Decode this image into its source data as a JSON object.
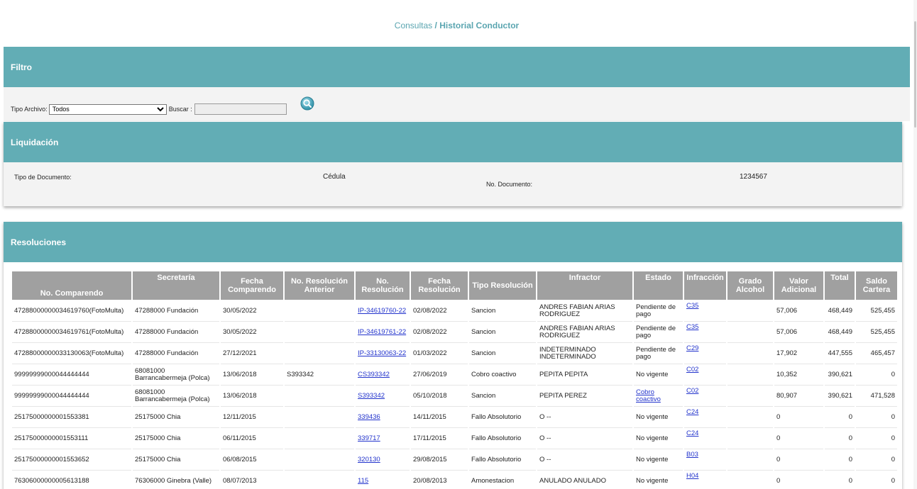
{
  "breadcrumb": {
    "parent": "Consultas",
    "separator": " / ",
    "current": "Historial Conductor"
  },
  "filtro": {
    "title": "Filtro",
    "tipo_archivo_label": "Tipo Archivo:",
    "tipo_archivo_value": "Todos",
    "buscar_label": "Buscar :",
    "buscar_value": "",
    "search_icon": "search-icon"
  },
  "liquidacion": {
    "title": "Liquidación",
    "tipo_documento_label": "Tipo de Documento:",
    "tipo_documento_value": "Cédula",
    "no_documento_label": "No. Documento:",
    "no_documento_value": "1234567"
  },
  "resoluciones": {
    "title": "Resoluciones",
    "columns": [
      "No. Comparendo",
      "Secretaría",
      "Fecha Comparendo",
      "No. Resolución Anterior",
      "No. Resolución",
      "Fecha Resolución",
      "Tipo Resolución",
      "Infractor",
      "Estado",
      "Infracción",
      "Grado Alcohol",
      "Valor Adicional",
      "Total",
      "Saldo Cartera"
    ],
    "rows": [
      {
        "comparendo": "47288000000034619760(FotoMulta)",
        "secretaria": "47288000 Fundación",
        "fecha_comparendo": "30/05/2022",
        "resolucion_anterior": "",
        "resolucion": "IP-34619760-22",
        "fecha_resolucion": "02/08/2022",
        "tipo": "Sancion",
        "infractor": "ANDRES FABIAN ARIAS RODRIGUEZ",
        "estado": "Pendiente de pago",
        "estado_link": false,
        "infraccion": "C35",
        "grado_alcohol": "",
        "valor_adicional": "57,006",
        "total": "468,449",
        "saldo": "525,455"
      },
      {
        "comparendo": "47288000000034619761(FotoMulta)",
        "secretaria": "47288000 Fundación",
        "fecha_comparendo": "30/05/2022",
        "resolucion_anterior": "",
        "resolucion": "IP-34619761-22",
        "fecha_resolucion": "02/08/2022",
        "tipo": "Sancion",
        "infractor": "ANDRES FABIAN ARIAS RODRIGUEZ",
        "estado": "Pendiente de pago",
        "estado_link": false,
        "infraccion": "C35",
        "grado_alcohol": "",
        "valor_adicional": "57,006",
        "total": "468,449",
        "saldo": "525,455"
      },
      {
        "comparendo": "47288000000033130063(FotoMulta)",
        "secretaria": "47288000 Fundación",
        "fecha_comparendo": "27/12/2021",
        "resolucion_anterior": "",
        "resolucion": "IP-33130063-22",
        "fecha_resolucion": "01/03/2022",
        "tipo": "Sancion",
        "infractor": "INDETERMINADO INDETERMINADO",
        "estado": "Pendiente de pago",
        "estado_link": false,
        "infraccion": "C29",
        "grado_alcohol": "",
        "valor_adicional": "17,902",
        "total": "447,555",
        "saldo": "465,457"
      },
      {
        "comparendo": "99999999000044444444",
        "secretaria": "68081000 Barrancabermeja (Polca)",
        "fecha_comparendo": "13/06/2018",
        "resolucion_anterior": "S393342",
        "resolucion": "CS393342",
        "fecha_resolucion": "27/06/2019",
        "tipo": "Cobro coactivo",
        "infractor": "PEPITA PEPITA",
        "estado": "No vigente",
        "estado_link": false,
        "infraccion": "C02",
        "grado_alcohol": "",
        "valor_adicional": "10,352",
        "total": "390,621",
        "saldo": "0"
      },
      {
        "comparendo": "99999999000044444444",
        "secretaria": "68081000 Barrancabermeja (Polca)",
        "fecha_comparendo": "13/06/2018",
        "resolucion_anterior": "",
        "resolucion": "S393342",
        "fecha_resolucion": "05/10/2018",
        "tipo": "Sancion",
        "infractor": "PEPITA PEREZ",
        "estado": "Cobro coactivo",
        "estado_link": true,
        "infraccion": "C02",
        "grado_alcohol": "",
        "valor_adicional": "80,907",
        "total": "390,621",
        "saldo": "471,528"
      },
      {
        "comparendo": "25175000000001553381",
        "secretaria": "25175000 Chia",
        "fecha_comparendo": "12/11/2015",
        "resolucion_anterior": "",
        "resolucion": "339436",
        "fecha_resolucion": "14/11/2015",
        "tipo": "Fallo Absolutorio",
        "infractor": "O --",
        "estado": "No vigente",
        "estado_link": false,
        "infraccion": "C24",
        "grado_alcohol": "",
        "valor_adicional": "0",
        "total": "0",
        "saldo": "0"
      },
      {
        "comparendo": "25175000000001553111",
        "secretaria": "25175000 Chia",
        "fecha_comparendo": "06/11/2015",
        "resolucion_anterior": "",
        "resolucion": "339717",
        "fecha_resolucion": "17/11/2015",
        "tipo": "Fallo Absolutorio",
        "infractor": "O --",
        "estado": "No vigente",
        "estado_link": false,
        "infraccion": "C24",
        "grado_alcohol": "",
        "valor_adicional": "0",
        "total": "0",
        "saldo": "0"
      },
      {
        "comparendo": "25175000000001553652",
        "secretaria": "25175000 Chia",
        "fecha_comparendo": "06/08/2015",
        "resolucion_anterior": "",
        "resolucion": "320130",
        "fecha_resolucion": "29/08/2015",
        "tipo": "Fallo Absolutorio",
        "infractor": "O --",
        "estado": "No vigente",
        "estado_link": false,
        "infraccion": "B03",
        "grado_alcohol": "",
        "valor_adicional": "0",
        "total": "0",
        "saldo": "0"
      },
      {
        "comparendo": "76306000000005613188",
        "secretaria": "76306000 Ginebra (Valle)",
        "fecha_comparendo": "08/07/2013",
        "resolucion_anterior": "",
        "resolucion": "115",
        "fecha_resolucion": "20/08/2013",
        "tipo": "Amonestacion",
        "infractor": "ANULADO ANULADO",
        "estado": "No vigente",
        "estado_link": false,
        "infraccion": "H04",
        "grado_alcohol": "",
        "valor_adicional": "0",
        "total": "0",
        "saldo": "0"
      }
    ]
  }
}
